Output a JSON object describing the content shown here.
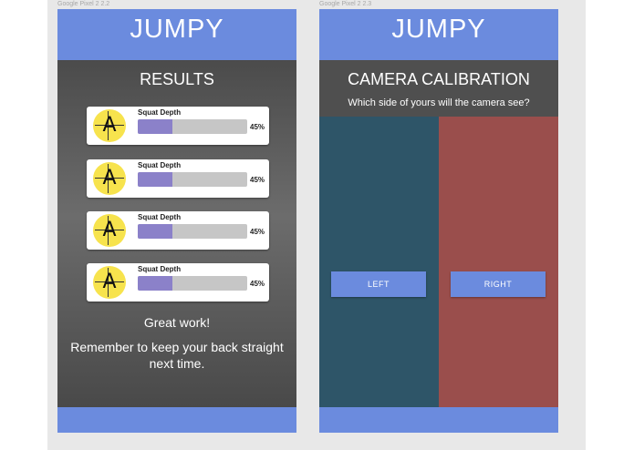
{
  "frames": [
    {
      "label": "Google Pixel 2 2.2",
      "app_title": "JUMPY",
      "screen_title": "RESULTS",
      "results": [
        {
          "metric": "Squat Depth",
          "percent_label": "45%",
          "progress": 0.32,
          "avatar_glyph": "A"
        },
        {
          "metric": "Squat Depth",
          "percent_label": "45%",
          "progress": 0.32,
          "avatar_glyph": "A"
        },
        {
          "metric": "Squat Depth",
          "percent_label": "45%",
          "progress": 0.32,
          "avatar_glyph": "A"
        },
        {
          "metric": "Squat Depth",
          "percent_label": "45%",
          "progress": 0.32,
          "avatar_glyph": "A"
        }
      ],
      "message_primary": "Great work!",
      "message_secondary": "Remember to keep your back straight next time."
    },
    {
      "label": "Google Pixel 2 2.3",
      "app_title": "JUMPY",
      "screen_title": "CAMERA CALIBRATION",
      "question": "Which side of yours will the camera see?",
      "left_button": "LEFT",
      "right_button": "RIGHT"
    }
  ],
  "colors": {
    "app_bar": "#6b8bde",
    "left_side": "#2e5568",
    "right_side": "#9a4e4c",
    "progress_fill": "#8b81c9",
    "progress_track": "#c6c6c6",
    "avatar": "#f7e34d"
  }
}
